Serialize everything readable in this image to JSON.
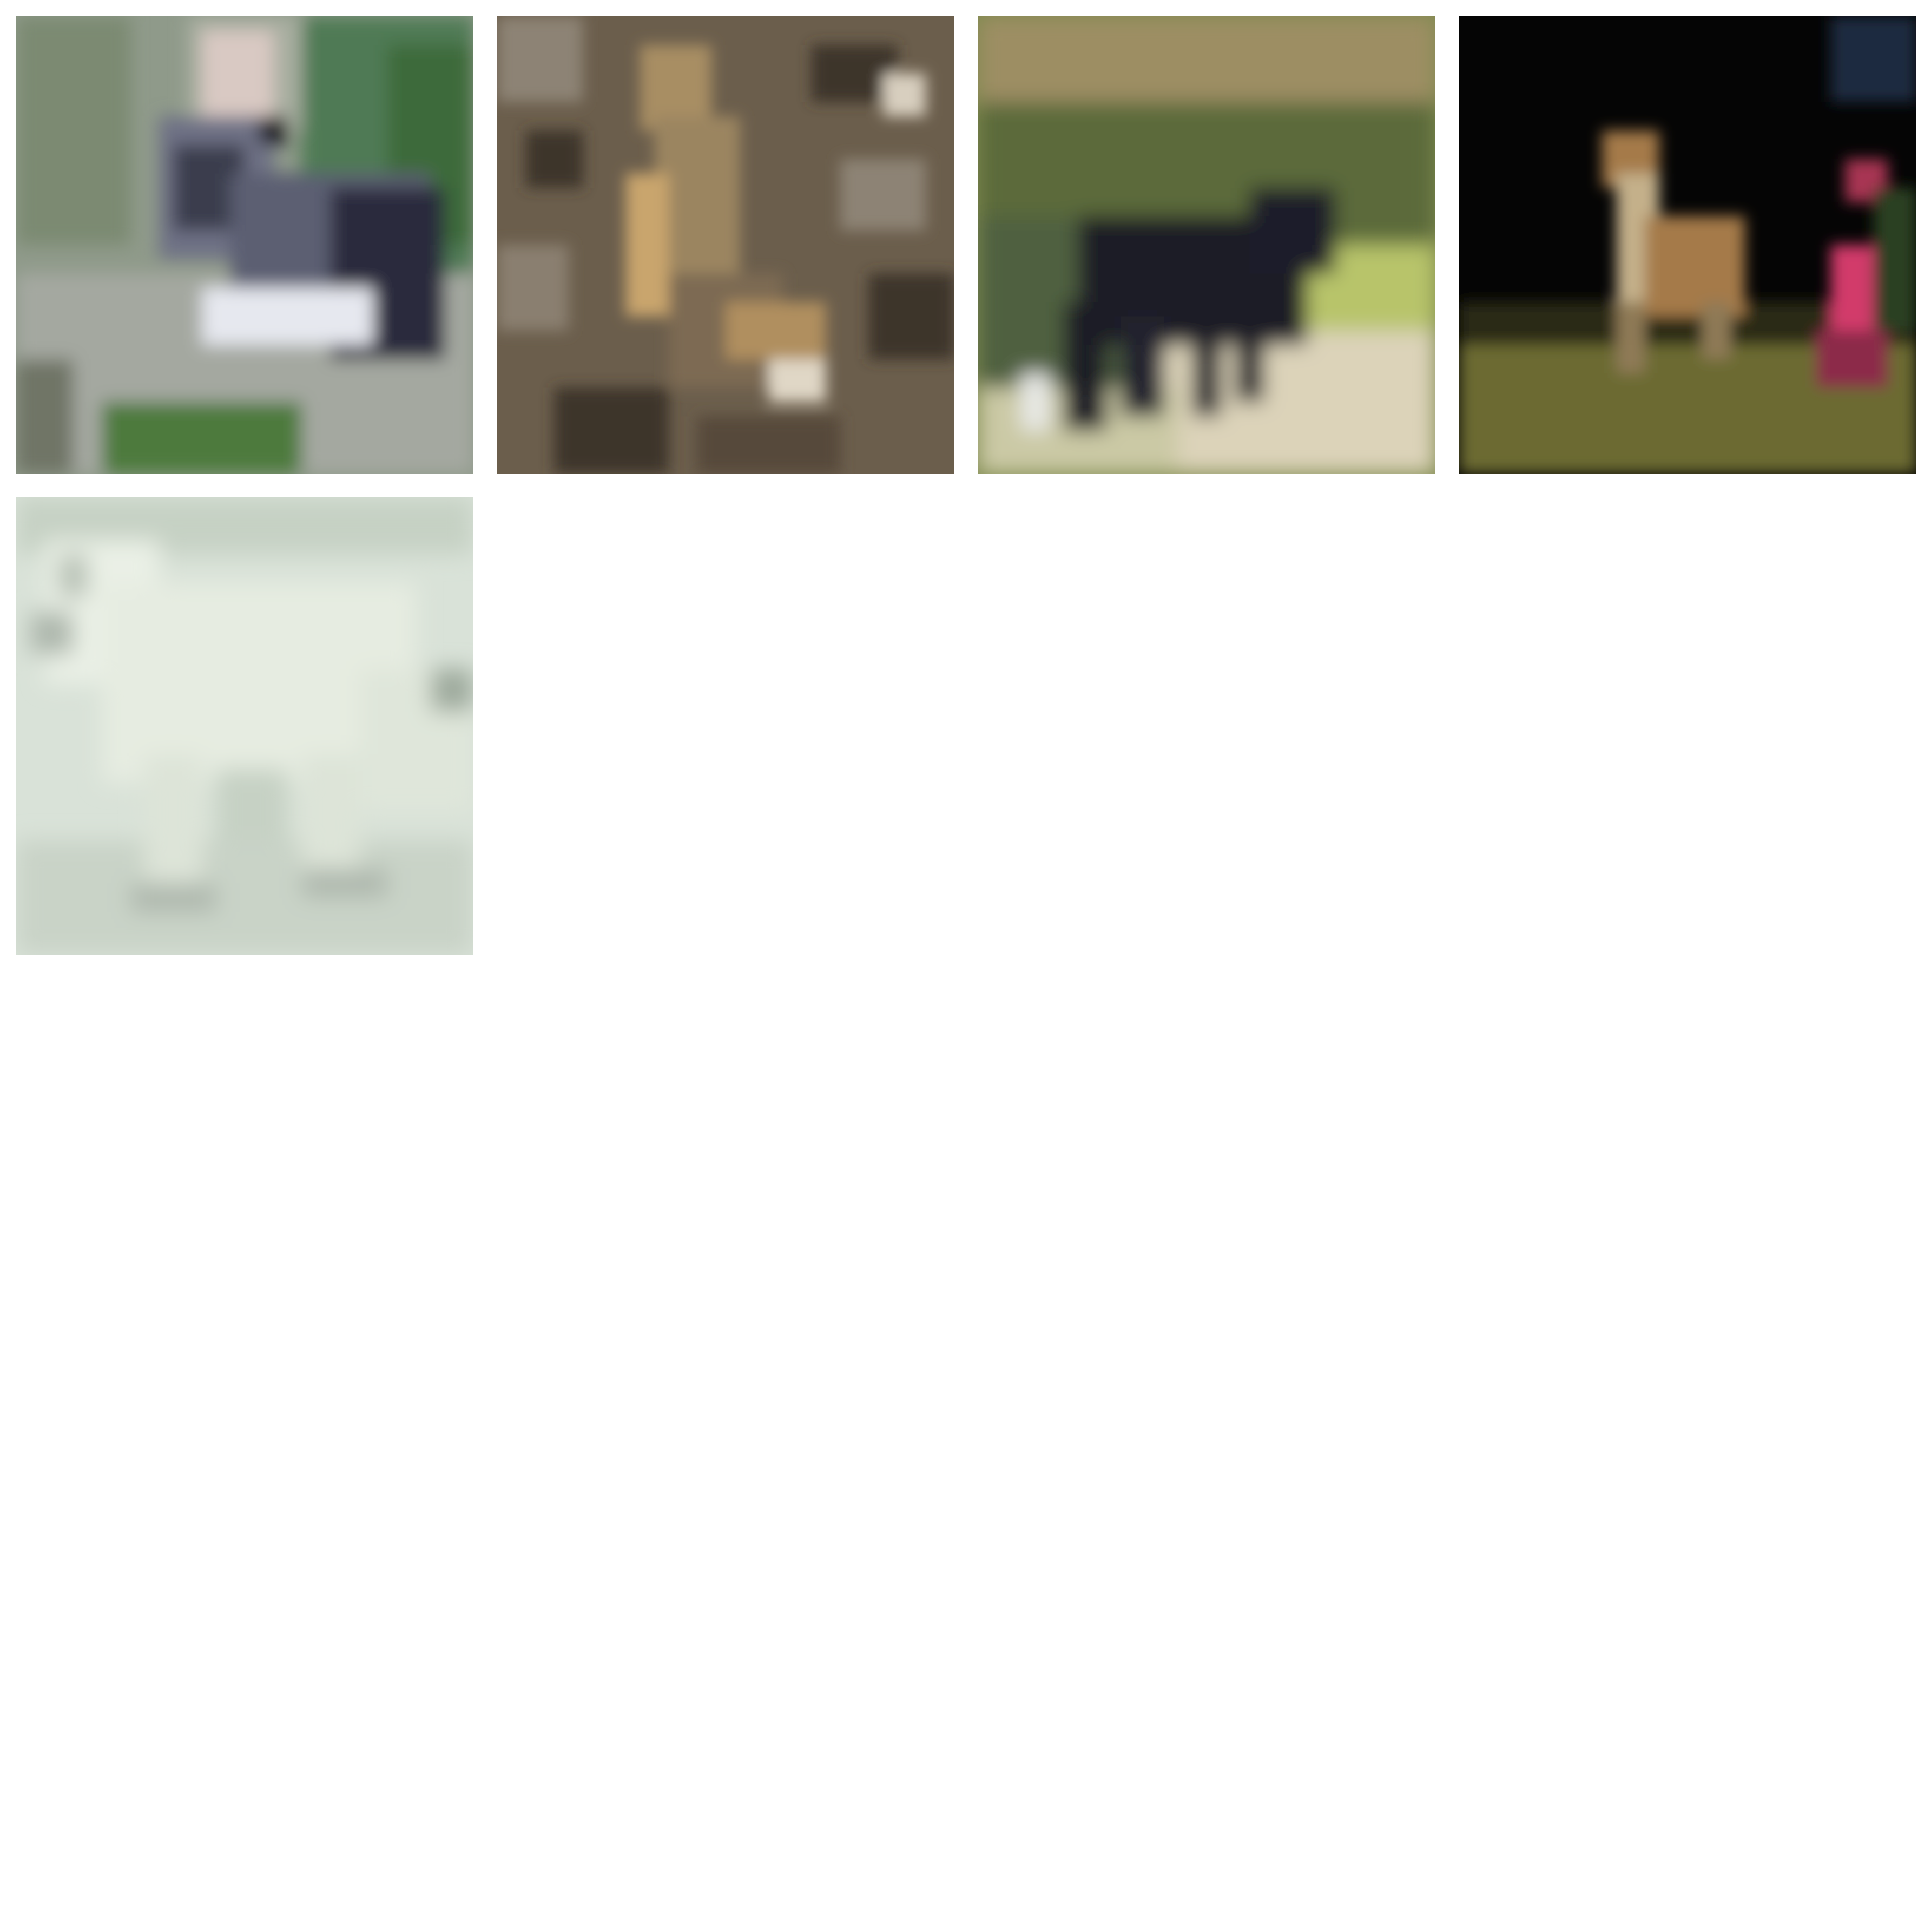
{
  "grid": {
    "columns": 4,
    "tiles": [
      {
        "subject": "grey-white-cat-icon",
        "palette": [
          "#8f9a8a",
          "#5d6f5a",
          "#b3b6b0",
          "#3b3c4d",
          "#e6e8ef",
          "#3c6b3b"
        ]
      },
      {
        "subject": "tan-cat-icon",
        "palette": [
          "#6b5e4c",
          "#a88e63",
          "#3d3429",
          "#8d8374",
          "#d8cfbf"
        ]
      },
      {
        "subject": "black-dog-icon",
        "palette": [
          "#7f8a4f",
          "#1b1a26",
          "#b8c46a",
          "#dcd3b9",
          "#5b6a3a"
        ]
      },
      {
        "subject": "fox-at-night-icon",
        "palette": [
          "#050505",
          "#a57a48",
          "#6c6a33",
          "#d23b6a",
          "#1a2a40"
        ]
      },
      {
        "subject": "white-arctic-fox-icon",
        "palette": [
          "#d9e2d8",
          "#eaf0e6",
          "#aeb8ad",
          "#c6d1c4"
        ]
      }
    ]
  }
}
